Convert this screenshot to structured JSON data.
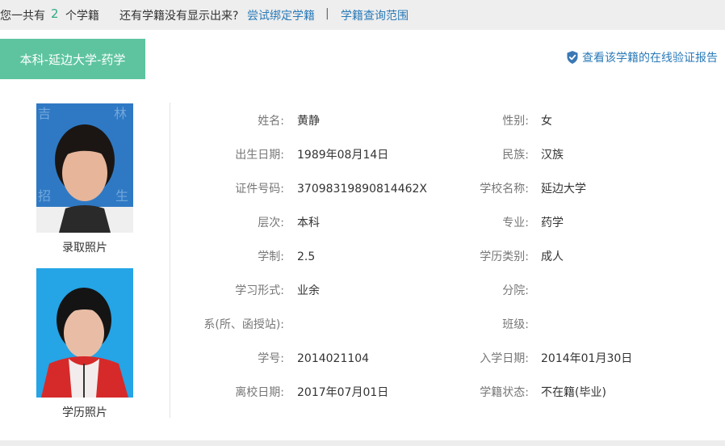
{
  "topbar": {
    "prefix": "您一共有",
    "count": "2",
    "suffix": "个学籍",
    "question": "还有学籍没有显示出来?",
    "bind_link": "尝试绑定学籍",
    "separator": "|",
    "scope_link": "学籍查询范围"
  },
  "record": {
    "tab_label": "本科-延边大学-药学",
    "verify_link": "查看该学籍的在线验证报告",
    "verify_icon": "shield-check-icon"
  },
  "photos": {
    "admission_caption": "录取照片",
    "diploma_caption": "学历照片"
  },
  "fields": {
    "name": {
      "label": "姓名:",
      "value": "黄静"
    },
    "gender": {
      "label": "性别:",
      "value": "女"
    },
    "birth_date": {
      "label": "出生日期:",
      "value": "1989年08月14日"
    },
    "ethnicity": {
      "label": "民族:",
      "value": "汉族"
    },
    "id_number": {
      "label": "证件号码:",
      "value": "37098319890814462X"
    },
    "school": {
      "label": "学校名称:",
      "value": "延边大学"
    },
    "level": {
      "label": "层次:",
      "value": "本科"
    },
    "major": {
      "label": "专业:",
      "value": "药学"
    },
    "duration": {
      "label": "学制:",
      "value": "2.5"
    },
    "education_type": {
      "label": "学历类别:",
      "value": "成人"
    },
    "study_mode": {
      "label": "学习形式:",
      "value": "业余"
    },
    "branch": {
      "label": "分院:",
      "value": ""
    },
    "department": {
      "label": "系(所、函授站):",
      "value": ""
    },
    "class_name": {
      "label": "班级:",
      "value": ""
    },
    "student_id": {
      "label": "学号:",
      "value": "2014021104"
    },
    "enroll_date": {
      "label": "入学日期:",
      "value": "2014年01月30日"
    },
    "leave_date": {
      "label": "离校日期:",
      "value": "2017年07月01日"
    },
    "status": {
      "label": "学籍状态:",
      "value": "不在籍(毕业)"
    }
  },
  "colors": {
    "tab_green": "#5ec4a0",
    "link_blue": "#2a7ab8",
    "count_green": "#2eaa85"
  }
}
